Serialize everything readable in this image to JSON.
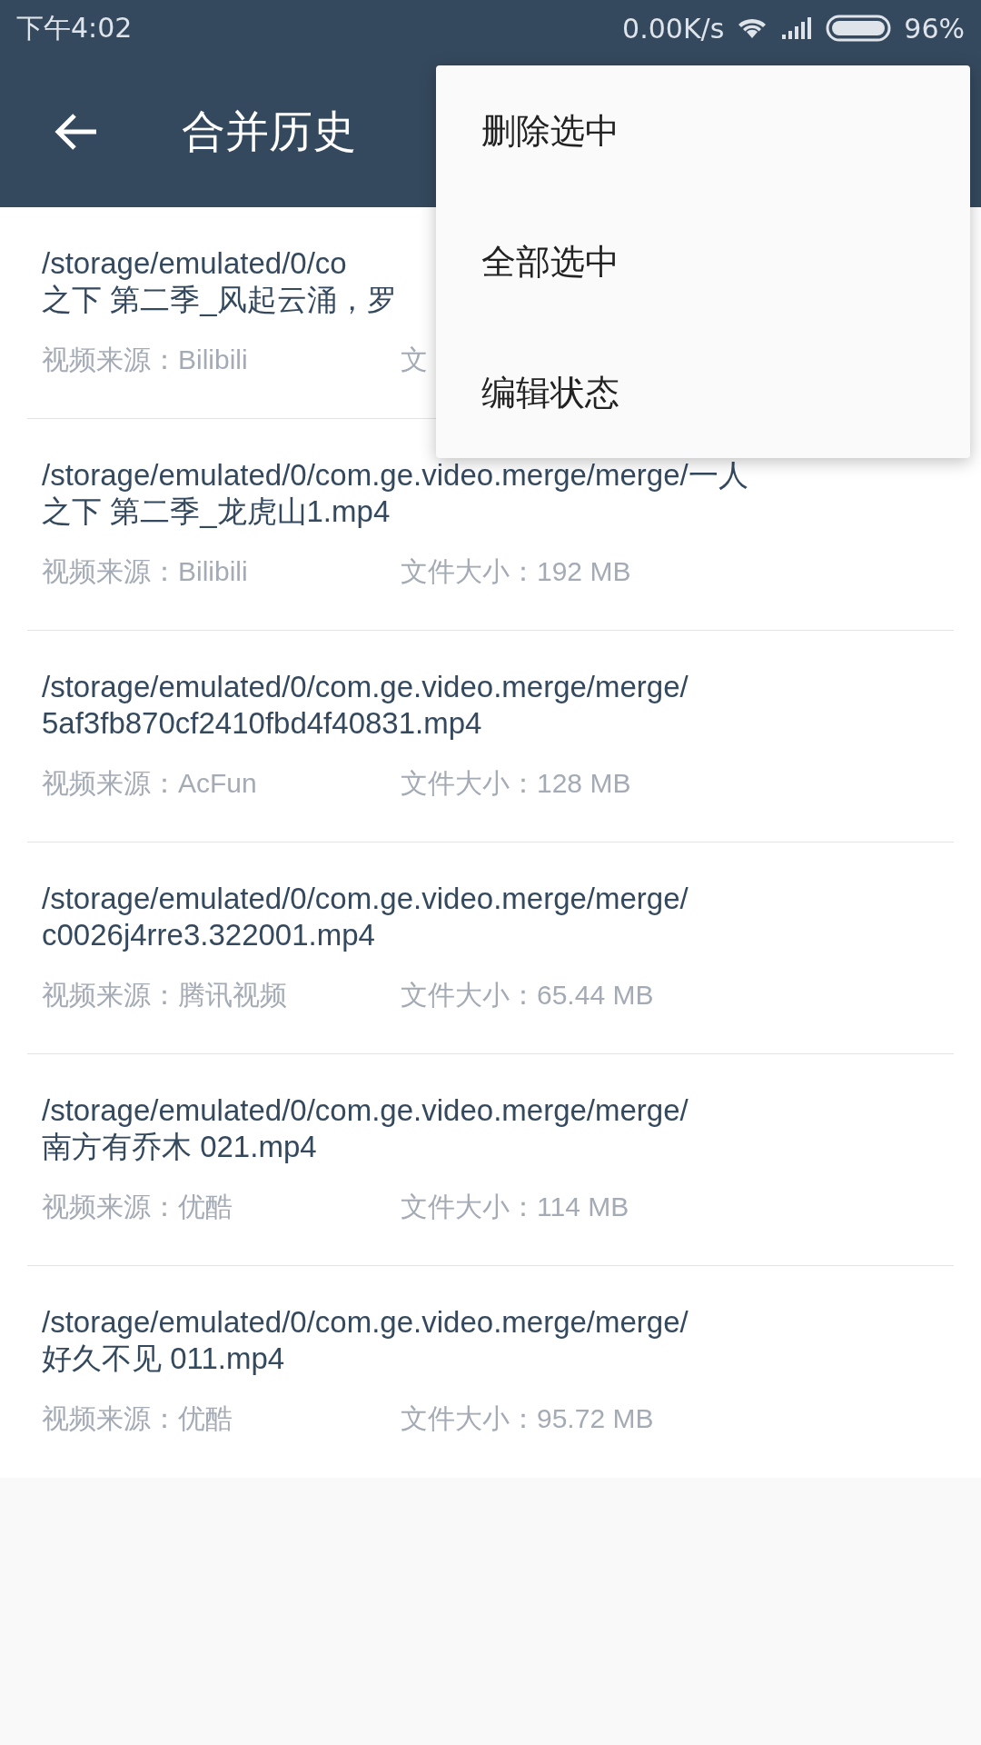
{
  "status_bar": {
    "time": "下午4:02",
    "speed": "0.00K/s",
    "battery": "96%"
  },
  "toolbar": {
    "title": "合并历史"
  },
  "rows": [
    {
      "path_lines": [
        "/storage/emulated/0/co",
        "之下 第二季_风起云涌，罗"
      ],
      "source": "视频来源：Bilibili",
      "size": "文"
    },
    {
      "path_lines": [
        "/storage/emulated/0/com.ge.video.merge/merge/一人",
        "之下 第二季_龙虎山1.mp4"
      ],
      "source": "视频来源：Bilibili",
      "size": "文件大小：192 MB"
    },
    {
      "path_lines": [
        "/storage/emulated/0/com.ge.video.merge/merge/",
        "5af3fb870cf2410fbd4f40831.mp4"
      ],
      "source": "视频来源：AcFun",
      "size": "文件大小：128 MB"
    },
    {
      "path_lines": [
        "/storage/emulated/0/com.ge.video.merge/merge/",
        "c0026j4rre3.322001.mp4"
      ],
      "source": "视频来源：腾讯视频",
      "size": "文件大小：65.44 MB"
    },
    {
      "path_lines": [
        "/storage/emulated/0/com.ge.video.merge/merge/",
        "南方有乔木 021.mp4"
      ],
      "source": "视频来源：优酷",
      "size": "文件大小：114 MB"
    },
    {
      "path_lines": [
        "/storage/emulated/0/com.ge.video.merge/merge/",
        "好久不见 011.mp4"
      ],
      "source": "视频来源：优酷",
      "size": "文件大小：95.72 MB"
    }
  ],
  "menu": {
    "items": [
      "删除选中",
      "全部选中",
      "编辑状态"
    ]
  }
}
